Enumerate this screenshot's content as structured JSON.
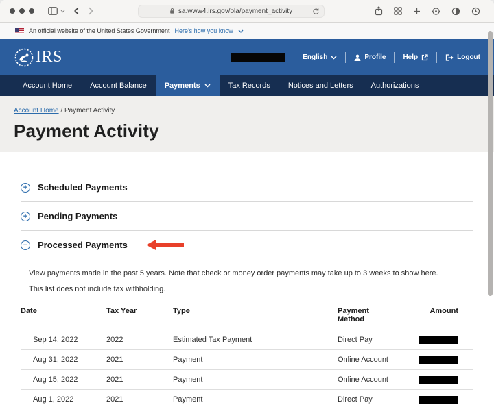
{
  "browser": {
    "url": "sa.www4.irs.gov/ola/payment_activity"
  },
  "gov_banner": {
    "text": "An official website of the United States Government",
    "link": "Here's how you know"
  },
  "header": {
    "logo_text": "IRS",
    "language": "English",
    "profile": "Profile",
    "help": "Help",
    "logout": "Logout"
  },
  "nav": {
    "items": [
      {
        "label": "Account Home",
        "active": false
      },
      {
        "label": "Account Balance",
        "active": false
      },
      {
        "label": "Payments",
        "active": true
      },
      {
        "label": "Tax Records",
        "active": false
      },
      {
        "label": "Notices and Letters",
        "active": false
      },
      {
        "label": "Authorizations",
        "active": false
      }
    ]
  },
  "breadcrumb": {
    "link": "Account Home",
    "separator": "/",
    "current": "Payment Activity"
  },
  "page": {
    "title": "Payment Activity"
  },
  "accordions": [
    {
      "label": "Scheduled Payments",
      "symbol": "+",
      "state": "collapsed"
    },
    {
      "label": "Pending Payments",
      "symbol": "+",
      "state": "collapsed"
    },
    {
      "label": "Processed Payments",
      "symbol": "−",
      "state": "expanded"
    }
  ],
  "processed": {
    "description": "View payments made in the past 5 years. Note that check or money order payments may take up to 3 weeks to show here.",
    "note": "This list does not include tax withholding.",
    "table": {
      "headers": [
        "Date",
        "Tax Year",
        "Type",
        "Payment Method",
        "Amount"
      ],
      "rows": [
        {
          "date": "Sep 14, 2022",
          "tax_year": "2022",
          "type": "Estimated Tax Payment",
          "method": "Direct Pay",
          "amount": "redacted"
        },
        {
          "date": "Aug 31, 2022",
          "tax_year": "2021",
          "type": "Payment",
          "method": "Online Account",
          "amount": "redacted"
        },
        {
          "date": "Aug 15, 2022",
          "tax_year": "2021",
          "type": "Payment",
          "method": "Online Account",
          "amount": "redacted"
        },
        {
          "date": "Aug 1, 2022",
          "tax_year": "2021",
          "type": "Payment",
          "method": "Direct Pay",
          "amount": "redacted"
        }
      ]
    }
  },
  "colors": {
    "header_blue": "#2b5d9d",
    "nav_navy": "#162e51",
    "link_blue": "#2c6cac",
    "arrow_red": "#e8402a",
    "band_gray": "#f0efed"
  }
}
